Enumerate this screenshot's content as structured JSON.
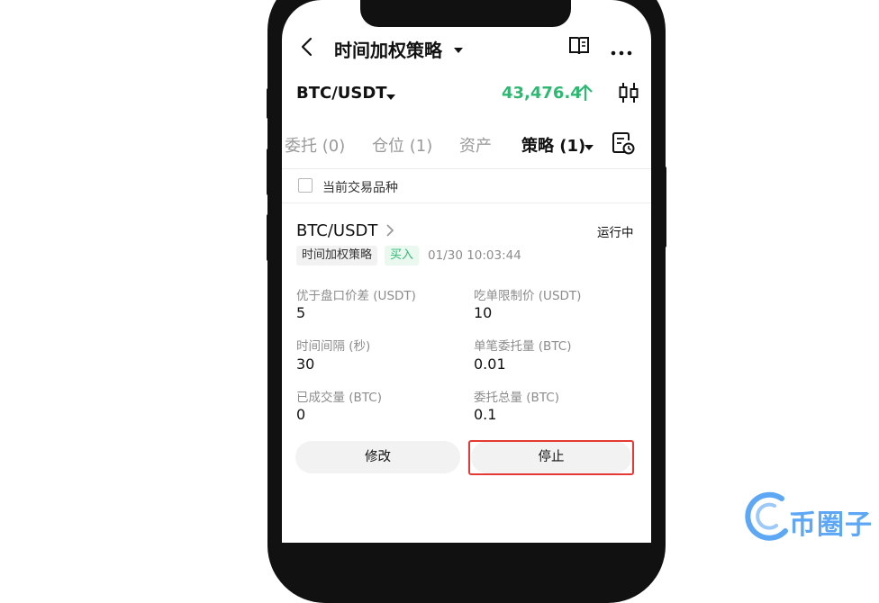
{
  "nav": {
    "title": "时间加权策略"
  },
  "ticker": {
    "pair": "BTC/USDT",
    "price": "43,476.4",
    "price_color": "#2eb872"
  },
  "tabs": [
    {
      "label": "委托 (0)",
      "active": false
    },
    {
      "label": "仓位 (1)",
      "active": false
    },
    {
      "label": "资产",
      "active": false
    },
    {
      "label": "策略 (1)",
      "active": true
    }
  ],
  "filter": {
    "current_pair_label": "当前交易品种"
  },
  "strategy": {
    "pair": "BTC/USDT",
    "status": "运行中",
    "type_tag": "时间加权策略",
    "side_tag": "买入",
    "side_color": "#2eb872",
    "timestamp": "01/30 10:03:44",
    "fields": [
      {
        "label": "优于盘口价差 (USDT)",
        "value": "5"
      },
      {
        "label": "吃单限制价 (USDT)",
        "value": "10"
      },
      {
        "label": "时间间隔 (秒)",
        "value": "30"
      },
      {
        "label": "单笔委托量 (BTC)",
        "value": "0.01"
      },
      {
        "label": "已成交量 (BTC)",
        "value": "0"
      },
      {
        "label": "委托总量 (BTC)",
        "value": "0.1"
      }
    ],
    "edit_label": "修改",
    "stop_label": "停止"
  },
  "watermark": {
    "text": "币圈子",
    "color": "#5ea7f4"
  }
}
